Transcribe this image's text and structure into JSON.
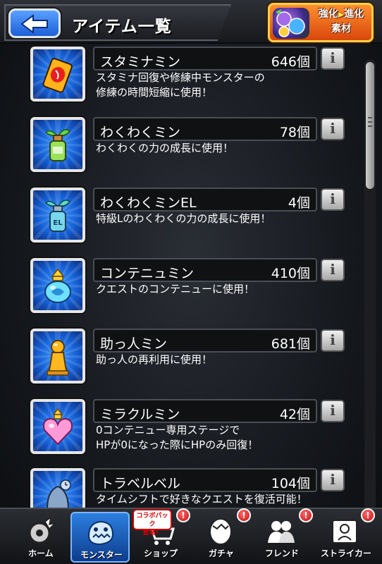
{
  "header": {
    "title": "アイテム一覧",
    "enhance_button": {
      "line1": "強化",
      "arrow": "▶",
      "line1b": "進化",
      "line2": "素材"
    }
  },
  "items": [
    {
      "name": "スタミナミン",
      "count": "646個",
      "desc_lines": [
        "スタミナ回復や修練中モンスターの",
        "修練の時間短縮に使用！"
      ],
      "icon": "stamina-can-icon"
    },
    {
      "name": "わくわくミン",
      "count": "78個",
      "desc_lines": [
        "わくわくの力の成長に使用！"
      ],
      "icon": "sprout-bottle-icon"
    },
    {
      "name": "わくわくミンEL",
      "count": "4個",
      "desc_lines": [
        "特級Lのわくわくの力の成長に使用！"
      ],
      "icon": "sprout-bottle-el-icon"
    },
    {
      "name": "コンテニュミン",
      "count": "410個",
      "desc_lines": [
        "クエストのコンテニューに使用！"
      ],
      "icon": "continue-jar-icon"
    },
    {
      "name": "助っ人ミン",
      "count": "681個",
      "desc_lines": [
        "助っ人の再利用に使用！"
      ],
      "icon": "helper-pawn-icon"
    },
    {
      "name": "ミラクルミン",
      "count": "42個",
      "desc_lines": [
        "0コンテニュー専用ステージで",
        "HPが0になった際にHPのみ回復！"
      ],
      "icon": "heart-potion-icon"
    },
    {
      "name": "トラベルベル",
      "count": "104個",
      "desc_lines": [
        "タイムシフトで好きなクエストを復活可能！"
      ],
      "icon": "travel-bell-icon"
    }
  ],
  "nav": {
    "items": [
      {
        "label": "ホーム",
        "icon": "home-gear-icon",
        "active": false,
        "badge": ""
      },
      {
        "label": "モンスター",
        "icon": "monster-icon",
        "active": true,
        "badge": ""
      },
      {
        "label": "ショップ",
        "icon": "shop-cart-icon",
        "active": false,
        "badge": "!"
      },
      {
        "label": "ガチャ",
        "icon": "gacha-egg-icon",
        "active": false,
        "badge": "!"
      },
      {
        "label": "フレンド",
        "icon": "friends-icon",
        "active": false,
        "badge": "!"
      },
      {
        "label": "ストライカー",
        "icon": "striker-card-icon",
        "active": false,
        "badge": "!"
      }
    ],
    "collab_tag": {
      "line1": "コラボパック",
      "line2": "登場！"
    }
  },
  "colors": {
    "accent_blue": "#1d5fd8",
    "enhance_orange": "#d8460c",
    "badge_red": "#c80c0c"
  }
}
